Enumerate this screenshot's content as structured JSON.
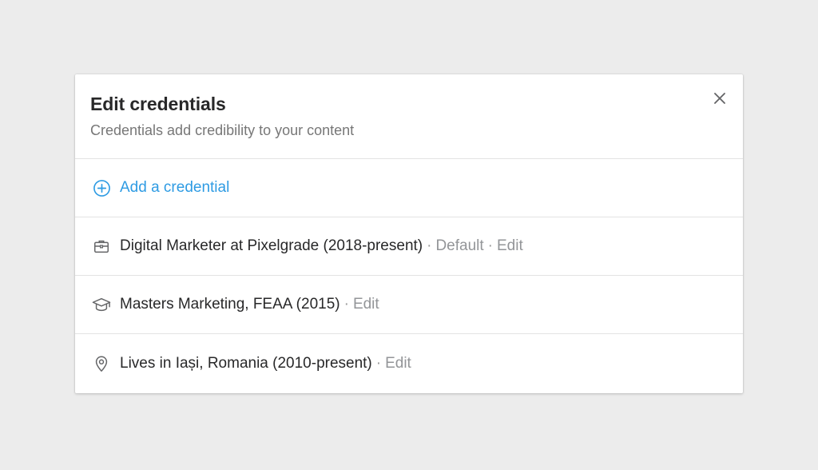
{
  "modal": {
    "title": "Edit credentials",
    "subtitle": "Credentials add credibility to your content",
    "close_icon": "close-icon"
  },
  "add_credential": {
    "label": "Add a credential",
    "icon": "plus-circle-icon",
    "color": "#2e9be3"
  },
  "credentials": [
    {
      "icon": "briefcase-icon",
      "text": "Digital Marketer at Pixelgrade (2018-present)",
      "separator": "·",
      "default_label": "Default",
      "separator2": "·",
      "edit_label": "Edit"
    },
    {
      "icon": "graduation-cap-icon",
      "text": "Masters Marketing, FEAA (2015)",
      "separator": "·",
      "edit_label": "Edit"
    },
    {
      "icon": "location-pin-icon",
      "text": "Lives in Iași, Romania (2010-present)",
      "separator": "·",
      "edit_label": "Edit"
    }
  ],
  "colors": {
    "background": "#ececec",
    "modal_bg": "#ffffff",
    "title": "#282829",
    "muted": "#939598",
    "accent": "#2e9be3",
    "divider": "#e3e3e3"
  }
}
